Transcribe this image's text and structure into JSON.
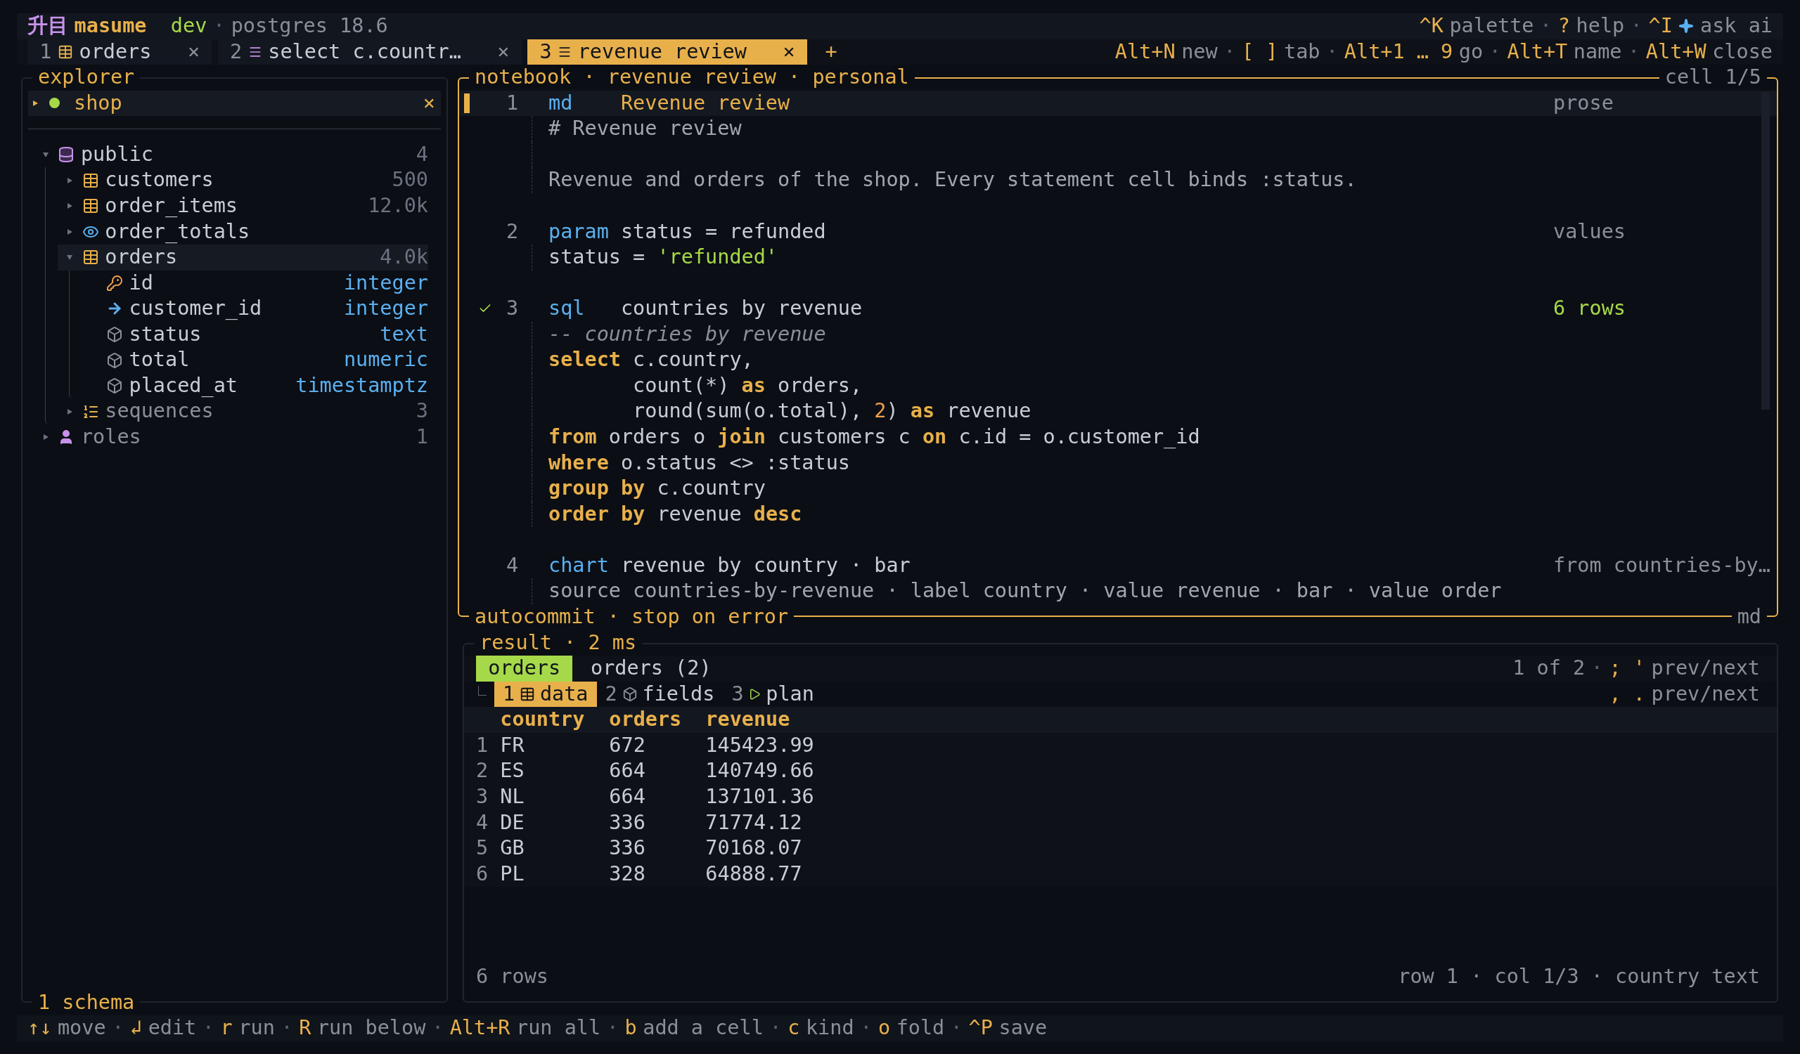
{
  "separator": "·",
  "app": {
    "logo": "升目",
    "name": "masume",
    "environment": "dev",
    "server": "postgres 18.6"
  },
  "top_hints": [
    {
      "key": "^K",
      "label": "palette",
      "kind": "plain"
    },
    {
      "key": "?",
      "label": "help",
      "kind": "plain"
    },
    {
      "key": "^I",
      "label": "ask ai",
      "kind": "ai"
    }
  ],
  "tabs": [
    {
      "number": "1",
      "kind": "table",
      "label": "orders",
      "close": "×",
      "selected": false
    },
    {
      "number": "2",
      "kind": "query",
      "label": "select c.countr…",
      "close": "×",
      "selected": false
    },
    {
      "number": "3",
      "kind": "query",
      "label": "revenue review",
      "close": "×",
      "selected": true
    }
  ],
  "new_tab": "+",
  "tab_hints": [
    {
      "key": "Alt+N",
      "label": "new"
    },
    {
      "key": "[ ]",
      "label": "tab"
    },
    {
      "key": "Alt+1 … 9",
      "label": "go"
    },
    {
      "key": "Alt+T",
      "label": "name"
    },
    {
      "key": "Alt+W",
      "label": "close"
    }
  ],
  "explorer": {
    "title": "explorer",
    "connection": {
      "name": "shop",
      "connected": true,
      "expanded": false,
      "selected": true,
      "close": "×"
    },
    "tree": [
      {
        "kind": "schema",
        "label": "public",
        "count": "4",
        "expanded": true,
        "selected": false,
        "children": [
          {
            "kind": "table",
            "label": "customers",
            "count": "500",
            "expanded": false,
            "selected": false
          },
          {
            "kind": "table",
            "label": "order_items",
            "count": "12.0k",
            "expanded": false,
            "selected": false
          },
          {
            "kind": "view",
            "label": "order_totals",
            "expanded": false,
            "selected": false
          },
          {
            "kind": "table",
            "label": "orders",
            "count": "4.0k",
            "expanded": true,
            "selected": true,
            "children": [
              {
                "kind": "pk-column",
                "label": "id",
                "type": "integer",
                "selected": false
              },
              {
                "kind": "fk-column",
                "label": "customer_id",
                "type": "integer",
                "selected": false
              },
              {
                "kind": "column",
                "label": "status",
                "type": "text",
                "selected": false
              },
              {
                "kind": "column",
                "label": "total",
                "type": "numeric",
                "selected": false
              },
              {
                "kind": "column",
                "label": "placed_at",
                "type": "timestamptz",
                "selected": false
              }
            ]
          },
          {
            "kind": "sequences",
            "label": "sequences",
            "count": "3",
            "expanded": false,
            "selected": false
          }
        ]
      },
      {
        "kind": "roles",
        "label": "roles",
        "count": "1",
        "expanded": false,
        "selected": false
      }
    ],
    "footer": "1 schema"
  },
  "notebook": {
    "title": "notebook · revenue review · personal",
    "position": "cell 1/5",
    "footer_left": "autocommit · stop on error",
    "footer_right": "md",
    "cells": [
      {
        "number": "1",
        "type": "md",
        "title": "Revenue review",
        "meta": "prose",
        "selected": true,
        "ran": false,
        "lines": [
          {
            "kind": "code",
            "tokens": [
              {
                "kind": "prose",
                "text": "# Revenue review"
              }
            ]
          },
          {
            "kind": "blank"
          },
          {
            "kind": "code",
            "tokens": [
              {
                "kind": "prose",
                "text": "Revenue and orders of the shop. Every statement cell binds :status."
              }
            ]
          }
        ]
      },
      {
        "number": "2",
        "type": "param",
        "title": "status = refunded",
        "meta": "values",
        "selected": false,
        "ran": false,
        "lines": [
          {
            "kind": "code",
            "tokens": [
              {
                "kind": "plain",
                "text": "status = "
              },
              {
                "kind": "string",
                "text": "'refunded'"
              }
            ]
          }
        ]
      },
      {
        "number": "3",
        "type": "sql",
        "title": "countries by revenue",
        "meta": "6 rows",
        "selected": false,
        "ran": true,
        "lines": [
          {
            "kind": "code",
            "tokens": [
              {
                "kind": "comment",
                "text": "-- countries by revenue"
              }
            ]
          },
          {
            "kind": "code",
            "tokens": [
              {
                "kind": "keyword",
                "text": "select"
              },
              {
                "kind": "plain",
                "text": " c.country,"
              }
            ]
          },
          {
            "kind": "code",
            "tokens": [
              {
                "kind": "plain",
                "text": "       count(*) "
              },
              {
                "kind": "keyword",
                "text": "as"
              },
              {
                "kind": "plain",
                "text": " orders,"
              }
            ]
          },
          {
            "kind": "code",
            "tokens": [
              {
                "kind": "plain",
                "text": "       round(sum(o.total), "
              },
              {
                "kind": "number",
                "text": "2"
              },
              {
                "kind": "plain",
                "text": ") "
              },
              {
                "kind": "keyword",
                "text": "as"
              },
              {
                "kind": "plain",
                "text": " revenue"
              }
            ]
          },
          {
            "kind": "code",
            "tokens": [
              {
                "kind": "keyword",
                "text": "from"
              },
              {
                "kind": "plain",
                "text": " orders o "
              },
              {
                "kind": "keyword",
                "text": "join"
              },
              {
                "kind": "plain",
                "text": " customers c "
              },
              {
                "kind": "keyword",
                "text": "on"
              },
              {
                "kind": "plain",
                "text": " c.id = o.customer_id"
              }
            ]
          },
          {
            "kind": "code",
            "tokens": [
              {
                "kind": "keyword",
                "text": "where"
              },
              {
                "kind": "plain",
                "text": " o.status <> :status"
              }
            ]
          },
          {
            "kind": "code",
            "tokens": [
              {
                "kind": "keyword",
                "text": "group by"
              },
              {
                "kind": "plain",
                "text": " c.country"
              }
            ]
          },
          {
            "kind": "code",
            "tokens": [
              {
                "kind": "keyword",
                "text": "order by"
              },
              {
                "kind": "plain",
                "text": " revenue "
              },
              {
                "kind": "keyword",
                "text": "desc"
              }
            ]
          }
        ]
      },
      {
        "number": "4",
        "type": "chart",
        "title": "revenue by country · bar",
        "meta": "from countries-by…",
        "selected": false,
        "ran": false,
        "lines": [
          {
            "kind": "code",
            "tokens": [
              {
                "kind": "prose",
                "text": "source countries-by-revenue · label country · value revenue · bar · value order"
              }
            ]
          }
        ]
      }
    ]
  },
  "result": {
    "title": "result · 2 ms",
    "result_tabs": [
      {
        "label": "orders",
        "selected": true
      },
      {
        "label": "orders (2)",
        "selected": false
      }
    ],
    "pager": {
      "position": "1 of 2",
      "key": "; '",
      "label": "prev/next"
    },
    "view_tabs": [
      {
        "number": "1",
        "kind": "data",
        "label": "data",
        "selected": true
      },
      {
        "number": "2",
        "kind": "fields",
        "label": "fields",
        "selected": false
      },
      {
        "number": "3",
        "kind": "plan",
        "label": "plan",
        "selected": false
      }
    ],
    "view_pager": {
      "key": ", .",
      "label": "prev/next"
    },
    "columns": [
      "country",
      "orders",
      "revenue"
    ],
    "rows": [
      {
        "number": "1",
        "cells": [
          "FR",
          "672",
          "145423.99"
        ]
      },
      {
        "number": "2",
        "cells": [
          "ES",
          "664",
          "140749.66"
        ]
      },
      {
        "number": "3",
        "cells": [
          "NL",
          "664",
          "137101.36"
        ]
      },
      {
        "number": "4",
        "cells": [
          "DE",
          "336",
          "71774.12"
        ]
      },
      {
        "number": "5",
        "cells": [
          "GB",
          "336",
          "70168.07"
        ]
      },
      {
        "number": "6",
        "cells": [
          "PL",
          "328",
          "64888.77"
        ]
      }
    ],
    "status_left": "6 rows",
    "status_right": "row 1 · col 1/3 · country text"
  },
  "footer_hints": [
    {
      "key": "↑↓",
      "label": "move"
    },
    {
      "key": "↲",
      "label": "edit"
    },
    {
      "key": "r",
      "label": "run"
    },
    {
      "key": "R",
      "label": "run below"
    },
    {
      "key": "Alt+R",
      "label": "run all"
    },
    {
      "key": "b",
      "label": "add a cell"
    },
    {
      "key": "c",
      "label": "kind"
    },
    {
      "key": "o",
      "label": "fold"
    },
    {
      "key": "^P",
      "label": "save"
    }
  ]
}
